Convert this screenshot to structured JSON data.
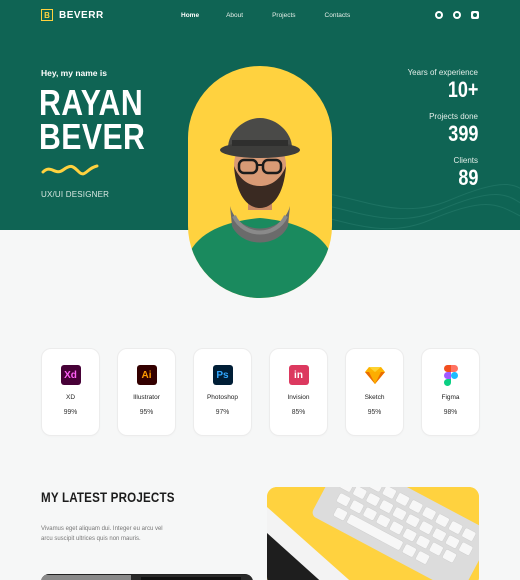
{
  "brand": {
    "logo_letter": "B",
    "name": "BEVERR",
    "color": "#ffd23f"
  },
  "nav": {
    "links": [
      {
        "label": "Home",
        "active": true
      },
      {
        "label": "About",
        "active": false
      },
      {
        "label": "Projects",
        "active": false
      },
      {
        "label": "Contacts",
        "active": false
      }
    ]
  },
  "socials": [
    "dribbble-icon",
    "behance-icon",
    "instagram-icon"
  ],
  "hero": {
    "greeting": "Hey, my name is",
    "first_name": "RAYAN",
    "last_name": "BEVER",
    "role": "UX/UI DESIGNER",
    "background": "#0f6454"
  },
  "stats": [
    {
      "label": "Years of experience",
      "value": "10+"
    },
    {
      "label": "Projects done",
      "value": "399"
    },
    {
      "label": "Clients",
      "value": "89"
    }
  ],
  "skills": [
    {
      "name": "XD",
      "percent": "99%",
      "icon_text": "Xd",
      "icon": "adobe-xd-icon",
      "bg": "#470137",
      "fg": "#ff61f6"
    },
    {
      "name": "Illustrator",
      "percent": "95%",
      "icon_text": "Ai",
      "icon": "adobe-illustrator-icon",
      "bg": "#330000",
      "fg": "#ff9a00"
    },
    {
      "name": "Photoshop",
      "percent": "97%",
      "icon_text": "Ps",
      "icon": "adobe-photoshop-icon",
      "bg": "#001e36",
      "fg": "#31a8ff"
    },
    {
      "name": "Invision",
      "percent": "85%",
      "icon_text": "in",
      "icon": "invision-icon",
      "bg": "#dc395f",
      "fg": "#ffffff"
    },
    {
      "name": "Sketch",
      "percent": "95%",
      "icon_text": "",
      "icon": "sketch-icon",
      "bg": "transparent",
      "fg": "#f7b500"
    },
    {
      "name": "Figma",
      "percent": "98%",
      "icon_text": "",
      "icon": "figma-icon",
      "bg": "transparent",
      "fg": "#f24e1e"
    }
  ],
  "projects": {
    "title": "MY LATEST PROJECTS",
    "description": "Vivamus eget aliquam dui. Integer eu arcu vel arcu suscipit ultrices quis non mauris."
  }
}
